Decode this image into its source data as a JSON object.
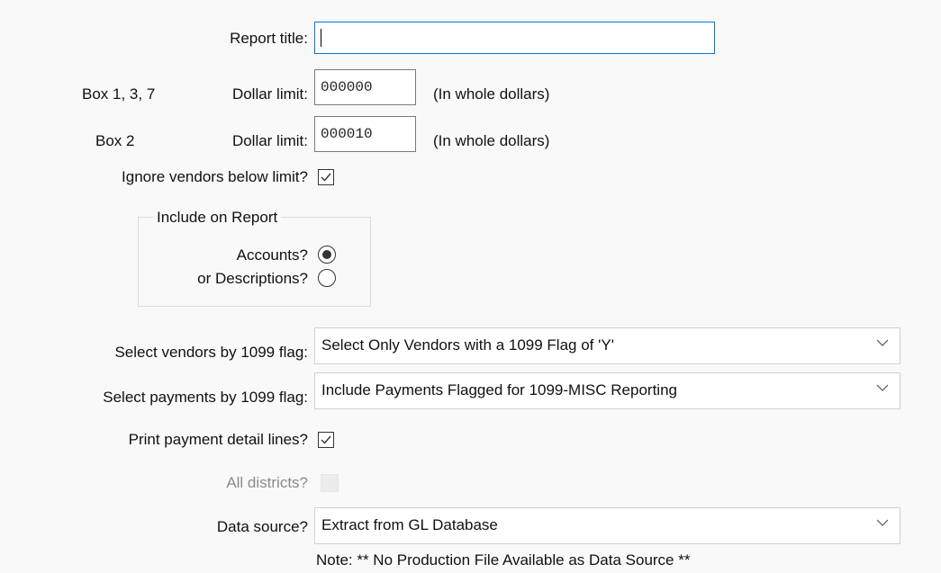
{
  "report_title": {
    "label": "Report title:",
    "value": ""
  },
  "box137": {
    "box_label": "Box 1, 3, 7",
    "limit_label": "Dollar limit:",
    "value": "000000",
    "note": "(In whole dollars)"
  },
  "box2": {
    "box_label": "Box 2",
    "limit_label": "Dollar limit:",
    "value": "000010",
    "note": "(In whole dollars)"
  },
  "ignore_vendors": {
    "label": "Ignore vendors below limit?",
    "checked": true
  },
  "include_on_report": {
    "legend": "Include on Report",
    "accounts_label": "Accounts?",
    "accounts_selected": true,
    "descriptions_label": "or Descriptions?",
    "descriptions_selected": false
  },
  "select_vendors": {
    "label": "Select vendors by 1099 flag:",
    "value": "Select Only Vendors with a 1099 Flag of 'Y'"
  },
  "select_payments": {
    "label": "Select payments by 1099 flag:",
    "value": "Include Payments Flagged for 1099-MISC Reporting"
  },
  "print_detail": {
    "label": "Print payment detail lines?",
    "checked": true
  },
  "all_districts": {
    "label": "All districts?",
    "checked": false,
    "enabled": false
  },
  "data_source": {
    "label": "Data source?",
    "value": "Extract from GL Database",
    "note": "Note: ** No Production File Available as Data Source **"
  },
  "icons": {
    "check": "checkmark-icon",
    "dropdown": "chevron-down-icon"
  },
  "colors": {
    "focus_border": "#0078d7",
    "background": "#f9f9f9",
    "disabled_text": "#8a8a8a"
  }
}
